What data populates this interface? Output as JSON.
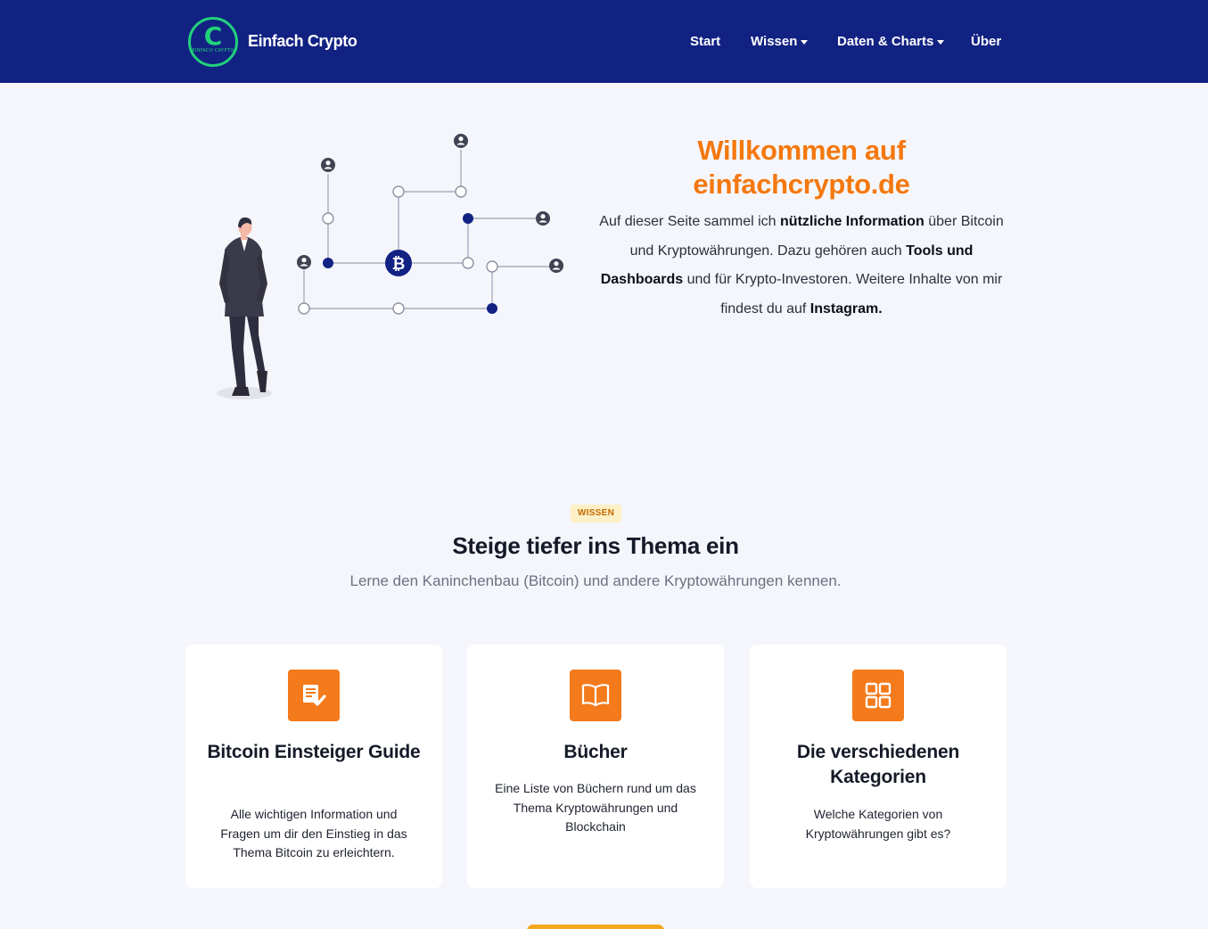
{
  "brand": {
    "name": "Einfach Crypto",
    "logo_letter": "C",
    "logo_subtext": "EINFACH CRYPTO"
  },
  "nav": {
    "start": "Start",
    "wissen": "Wissen",
    "daten": "Daten & Charts",
    "ueber": "Über"
  },
  "hero": {
    "title_line1": "Willkommen auf",
    "title_line2": "einfachcrypto.de",
    "text": {
      "p1": "Auf dieser Seite sammel ich ",
      "b1": "nützliche Information",
      "p2": " über Bitcoin und Kryptowährungen. Dazu gehören auch ",
      "b2": "Tools und Dashboards",
      "p3": " und für Krypto-Investoren. Weitere Inhalte von mir findest du auf ",
      "b3": "Instagram."
    }
  },
  "section": {
    "badge": "WISSEN",
    "title": "Steige tiefer ins Thema ein",
    "subtitle": "Lerne den Kaninchenbau (Bitcoin) und andere Kryptowährungen kennen."
  },
  "cards": [
    {
      "icon": "checklist-icon",
      "title": "Bitcoin Einsteiger Guide",
      "text": "Alle wichtigen Information und Fragen um dir den Einstieg in das Thema Bitcoin zu erleichtern."
    },
    {
      "icon": "book-icon",
      "title": "Bücher",
      "text": "Eine Liste von Büchern rund um das Thema Kryptowährungen und Blockchain"
    },
    {
      "icon": "grid-icon",
      "title": "Die verschiedenen Kategorien",
      "text": "Welche Kategorien von Kryptowährungen gibt es?"
    }
  ],
  "colors": {
    "navbar": "#122283",
    "accent": "#f47a1c",
    "logo_green": "#21d17a",
    "node_blue": "#122283"
  }
}
